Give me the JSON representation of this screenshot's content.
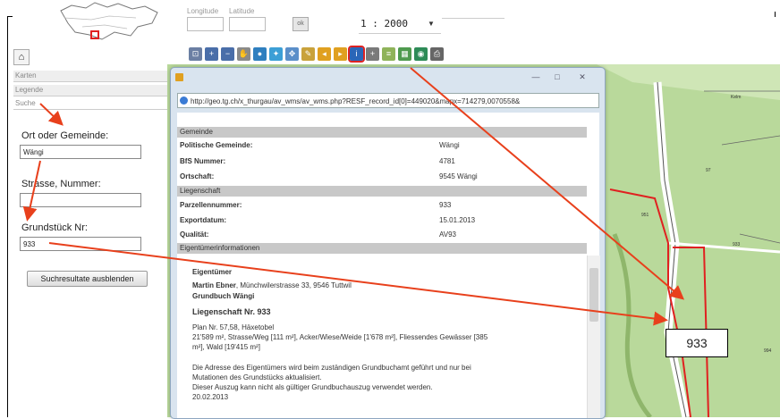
{
  "header": {
    "longitude_label": "Longitude",
    "latitude_label": "Latitude",
    "ok_label": "ok",
    "scale": "1 : 2000"
  },
  "toolbar": {
    "tools": [
      {
        "icon": "zoom-box-icon",
        "color": "#6b7fa3"
      },
      {
        "icon": "zoom-in-icon",
        "color": "#4a6ea9"
      },
      {
        "icon": "zoom-out-icon",
        "color": "#4a6ea9"
      },
      {
        "icon": "pan-hand-icon",
        "color": "#8a8a8a"
      },
      {
        "icon": "globe-icon",
        "color": "#2f7fbf"
      },
      {
        "icon": "navigate-icon",
        "color": "#3c9fd6"
      },
      {
        "icon": "move-icon",
        "color": "#5b8fc9"
      },
      {
        "icon": "measure-pen-icon",
        "color": "#c9a23b"
      },
      {
        "icon": "previous-view-icon",
        "color": "#e0a020"
      },
      {
        "icon": "next-view-icon",
        "color": "#e0a020"
      },
      {
        "icon": "info-icon",
        "color": "#2a66b8"
      },
      {
        "icon": "crosshair-icon",
        "color": "#7a7a7a"
      },
      {
        "icon": "layers-icon",
        "color": "#8fb35a"
      },
      {
        "icon": "legend-icon",
        "color": "#4f9a4f"
      },
      {
        "icon": "world-icon",
        "color": "#2e8b57"
      },
      {
        "icon": "print-icon",
        "color": "#666666"
      }
    ]
  },
  "left_panel": {
    "karten": "Karten",
    "legende": "Legende",
    "suche": "Suche",
    "ort_label": "Ort oder Gemeinde:",
    "ort_value": "Wängi",
    "strasse_label": "Strasse, Nummer:",
    "strasse_value": "",
    "grundstueck_label": "Grundstück Nr:",
    "grundstueck_value": "933",
    "hide_button": "Suchresultate ausblenden"
  },
  "popup": {
    "url": "http://geo.tg.ch/x_thurgau/av_wms/av_wms.php?RESF_record_id[0]=449020&mapx=714279,0070558&",
    "sections": {
      "gemeinde": "Gemeinde",
      "liegenschaft": "Liegenschaft",
      "eigentuemer": "Eigentümerinformationen"
    },
    "rows": {
      "politische_gemeinde_key": "Politische Gemeinde:",
      "politische_gemeinde_val": "Wängi",
      "bfs_key": "BfS Nummer:",
      "bfs_val": "4781",
      "ortschaft_key": "Ortschaft:",
      "ortschaft_val": "9545 Wängi",
      "parzelle_key": "Parzellennummer:",
      "parzelle_val": "933",
      "exportdatum_key": "Exportdatum:",
      "exportdatum_val": "15.01.2013",
      "qualitaet_key": "Qualität:",
      "qualitaet_val": "AV93"
    },
    "owner": {
      "heading": "Eigentümer",
      "name": "Martin Ebner",
      "address": ", Münchwilerstrasse 33, 9546 Tuttwil",
      "grundbuch": "Grundbuch Wängi",
      "liegenschaft": "Liegenschaft Nr. 933",
      "plan": "Plan Nr. 57,58, Häxetobel",
      "area": "21'589 m², Strasse/Weg [111 m²], Acker/Wiese/Weide [1'678 m²], Fliessendes Gewässer [385",
      "area2": "m²], Wald [19'415 m²]",
      "note1": "Die Adresse des Eigentümers wird beim zuständigen Grundbuchamt geführt und nur bei",
      "note2": "Mutationen des Grundstücks aktualisiert.",
      "note3": "Dieser Auszug kann nicht als gültiger Grundbuchauszug verwendet werden.",
      "date": "20.02.2013"
    }
  },
  "map": {
    "parcel_labels": [
      "Kelm",
      "97",
      "951",
      "933",
      "994"
    ],
    "fill_color": "#b9d99b",
    "road_color": "#ffffff",
    "parcel_outline": "#e02020"
  },
  "annotation": {
    "callout": "933",
    "arrow_color": "#e8401c"
  }
}
